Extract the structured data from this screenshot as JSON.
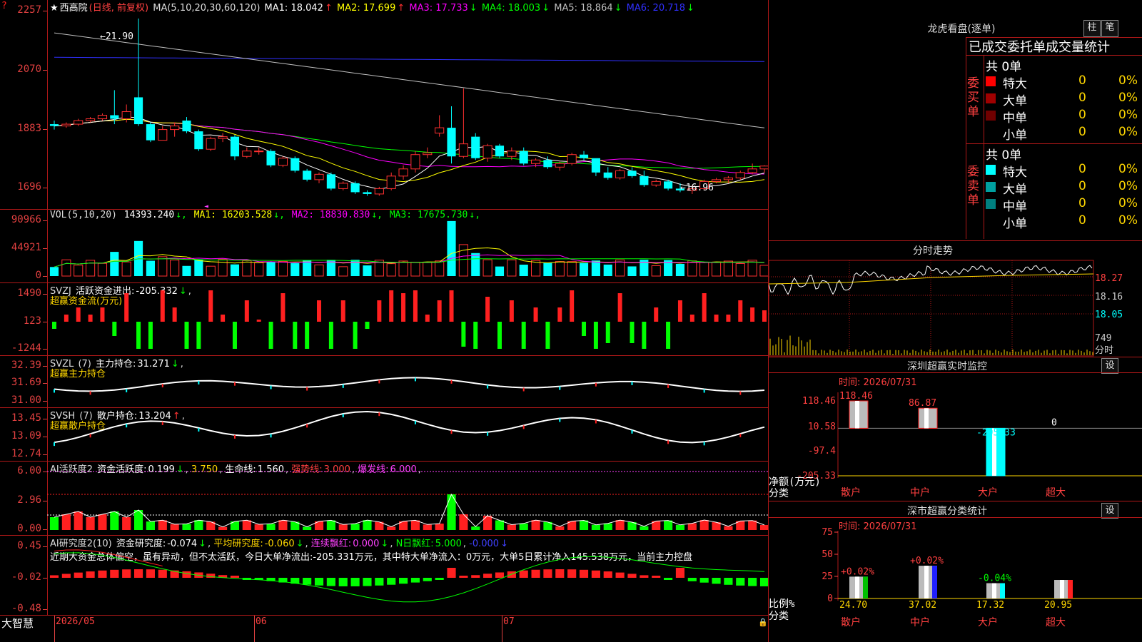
{
  "app": {
    "brand": "大智慧",
    "stock_title": "西高院",
    "period": "(日线, 前复权)",
    "star": "★",
    "marker": "?"
  },
  "main": {
    "ma_params": "MA(5,10,20,30,60,120)",
    "ma": [
      {
        "label": "MA1:",
        "value": "18.042",
        "arrow": "↑",
        "color": "#ffffff"
      },
      {
        "label": "MA2:",
        "value": "17.699",
        "arrow": "↑",
        "color": "#ffff00"
      },
      {
        "label": "MA3:",
        "value": "17.733",
        "arrow": "↓",
        "color": "#ff00ff"
      },
      {
        "label": "MA4:",
        "value": "18.003",
        "arrow": "↓",
        "color": "#00ff00"
      },
      {
        "label": "MA5:",
        "value": "18.864",
        "arrow": "↓",
        "color": "#c0c0c0"
      },
      {
        "label": "MA6:",
        "value": "20.718",
        "arrow": "↓",
        "color": "#3030ff"
      }
    ],
    "y_labels": [
      "2257",
      "2070",
      "1883",
      "1696"
    ],
    "high_label": "21.90",
    "low_label": "16.96"
  },
  "vol": {
    "params": "VOL(5,10,20)",
    "value": "14393.240",
    "items": [
      {
        "label": "MA1:",
        "value": "16203.528",
        "arrow": "↓",
        "color": "#ffff00"
      },
      {
        "label": "MA2:",
        "value": "18830.830",
        "arrow": "↓",
        "color": "#ff00ff"
      },
      {
        "label": "MA3:",
        "value": "17675.730",
        "arrow": "↓",
        "color": "#00ff00"
      }
    ],
    "y_labels": [
      "90966",
      "44921",
      "0"
    ]
  },
  "svzj": {
    "name": "SVZJ",
    "label": "活跃资金进出:",
    "value": "-205.332",
    "arrow": "↓",
    "subtitle": "超赢资金流(万元)",
    "y_labels": [
      "1490",
      "123",
      "-1244"
    ]
  },
  "svzl": {
    "name": "SVZL",
    "params": "(7)",
    "label": "主力持仓:",
    "value": "31.271",
    "arrow": "↓",
    "subtitle": "超赢主力持仓",
    "y_labels": [
      "32.39",
      "31.69",
      "31.00"
    ]
  },
  "svsh": {
    "name": "SVSH",
    "params": "(7)",
    "label": "散户持仓:",
    "value": "13.204",
    "arrow": "↑",
    "subtitle": "超赢散户持仓",
    "y_labels": [
      "13.45",
      "13.09",
      "12.74"
    ]
  },
  "ai_active": {
    "name": "AI活跃度2",
    "label1": "资金活跃度:",
    "v1": "0.199",
    "a1": "↓",
    "v2": "3.750",
    "label3": "生命线:",
    "v3": "1.560",
    "label4": "强势线:",
    "v4": "3.000",
    "label5": "爆发线:",
    "v5": "6.000",
    "y_labels": [
      "6.00",
      "2.96",
      "0.00"
    ]
  },
  "ai_research": {
    "name": "AI研究度2(10)",
    "label1": "资金研究度:",
    "v1": "-0.074",
    "a1": "↓",
    "label2": "平均研究度:",
    "v2": "-0.060",
    "a2": "↓",
    "label3": "连续飘红:",
    "v3": "0.000",
    "a3": "↓",
    "label4": "N日飘红:",
    "v4": "5.000",
    "v5": "-0.000",
    "a5": "↓",
    "comment": "近期大资金总体偏空，虽有异动，但不太活跃，今日大单净流出:-205.331万元，其中特大单净流入：0万元，大单5日累计净入145.538万元，当前主力控盘",
    "y_labels": [
      "0.45",
      "-0.02",
      "-0.48"
    ]
  },
  "x_axis": {
    "labels": [
      "2026/05",
      "06",
      "07"
    ]
  },
  "lhb": {
    "title": "龙虎看盘(逐单)",
    "btn1": "柱",
    "btn2": "笔",
    "tabs": "已成交委托单成交量统计",
    "buy": {
      "side": "委买单",
      "total": "共 0单",
      "rows": [
        {
          "name": "特大",
          "count": "0",
          "pct": "0%",
          "color": "#ff0000"
        },
        {
          "name": "大单",
          "count": "0",
          "pct": "0%",
          "color": "#a00000"
        },
        {
          "name": "中单",
          "count": "0",
          "pct": "0%",
          "color": "#700000"
        },
        {
          "name": "小单",
          "count": "0",
          "pct": "0%",
          "color": "#000000"
        }
      ]
    },
    "sell": {
      "side": "委卖单",
      "total": "共 0单",
      "rows": [
        {
          "name": "特大",
          "count": "0",
          "pct": "0%",
          "color": "#00ffff"
        },
        {
          "name": "大单",
          "count": "0",
          "pct": "0%",
          "color": "#00a0a0"
        },
        {
          "name": "中单",
          "count": "0",
          "pct": "0%",
          "color": "#008080"
        },
        {
          "name": "小单",
          "count": "0",
          "pct": "0%",
          "color": "#000000"
        }
      ]
    }
  },
  "fenshi": {
    "title": "分时走势",
    "y_labels": [
      "18.27",
      "18.16",
      "18.05",
      "749"
    ],
    "unit": "分时"
  },
  "sz_monitor": {
    "title": "深圳超赢实时监控",
    "btn": "设",
    "time_label": "时间:",
    "time": "2026/07/31",
    "y_labels": [
      "118.46",
      "10.58",
      "-97.4",
      "-205.33"
    ],
    "unit": "净额(万元)",
    "cat_label": "分类",
    "categories": [
      "散户",
      "中户",
      "大户",
      "超大"
    ],
    "values": [
      118.46,
      86.87,
      -205.33,
      0
    ],
    "value_labels": [
      "118.46",
      "86.87",
      "-205.33",
      "0"
    ]
  },
  "sz_classify": {
    "title": "深市超赢分类统计",
    "btn": "设",
    "time_label": "时间:",
    "time": "2026/07/31",
    "y_labels": [
      "75",
      "50",
      "25",
      "0"
    ],
    "unit": "比例%",
    "cat_label": "分类",
    "categories": [
      "散户",
      "中户",
      "大户",
      "超大"
    ],
    "values": [
      24.7,
      37.02,
      17.32,
      20.95
    ],
    "changes": [
      "+0.02%",
      "+0.02%",
      "-0.04%",
      ""
    ]
  },
  "chart_data": {
    "type": "candlestick",
    "title": "西高院 (日线, 前复权)",
    "x_axis_labels": [
      "2026/05",
      "06",
      "07"
    ],
    "y_range": [
      16.96,
      21.9
    ],
    "candles": [
      {
        "o": 18.95,
        "h": 19.05,
        "l": 18.8,
        "c": 18.9
      },
      {
        "o": 18.9,
        "h": 19.0,
        "l": 18.85,
        "c": 18.95
      },
      {
        "o": 18.95,
        "h": 19.1,
        "l": 18.9,
        "c": 19.05
      },
      {
        "o": 19.05,
        "h": 19.15,
        "l": 19.0,
        "c": 19.1
      },
      {
        "o": 19.1,
        "h": 19.25,
        "l": 19.05,
        "c": 19.2
      },
      {
        "o": 19.2,
        "h": 19.9,
        "l": 18.95,
        "c": 19.1
      },
      {
        "o": 19.1,
        "h": 19.5,
        "l": 19.0,
        "c": 19.3
      },
      {
        "o": 19.7,
        "h": 21.9,
        "l": 18.9,
        "c": 18.95
      },
      {
        "o": 18.95,
        "h": 19.0,
        "l": 18.45,
        "c": 18.5
      },
      {
        "o": 18.5,
        "h": 18.9,
        "l": 18.5,
        "c": 18.8
      },
      {
        "o": 18.8,
        "h": 19.0,
        "l": 18.6,
        "c": 18.9
      },
      {
        "o": 19.05,
        "h": 19.15,
        "l": 18.7,
        "c": 18.75
      },
      {
        "o": 18.75,
        "h": 18.8,
        "l": 18.2,
        "c": 18.25
      },
      {
        "o": 18.25,
        "h": 18.6,
        "l": 18.2,
        "c": 18.55
      },
      {
        "o": 18.55,
        "h": 18.7,
        "l": 18.45,
        "c": 18.6
      },
      {
        "o": 18.6,
        "h": 18.65,
        "l": 17.95,
        "c": 18.05
      },
      {
        "o": 18.05,
        "h": 18.3,
        "l": 18.0,
        "c": 18.2
      },
      {
        "o": 18.2,
        "h": 18.3,
        "l": 18.1,
        "c": 18.2
      },
      {
        "o": 18.2,
        "h": 18.25,
        "l": 17.75,
        "c": 17.8
      },
      {
        "o": 17.8,
        "h": 18.05,
        "l": 17.75,
        "c": 18.0
      },
      {
        "o": 18.0,
        "h": 18.05,
        "l": 17.6,
        "c": 17.65
      },
      {
        "o": 17.65,
        "h": 17.7,
        "l": 17.35,
        "c": 17.4
      },
      {
        "o": 17.4,
        "h": 17.6,
        "l": 17.3,
        "c": 17.55
      },
      {
        "o": 17.55,
        "h": 17.6,
        "l": 17.1,
        "c": 17.15
      },
      {
        "o": 17.15,
        "h": 17.35,
        "l": 17.1,
        "c": 17.3
      },
      {
        "o": 17.3,
        "h": 17.35,
        "l": 17.0,
        "c": 17.05
      },
      {
        "o": 17.05,
        "h": 17.1,
        "l": 16.95,
        "c": 17.0
      },
      {
        "o": 17.0,
        "h": 17.2,
        "l": 16.95,
        "c": 17.15
      },
      {
        "o": 17.15,
        "h": 17.6,
        "l": 17.1,
        "c": 17.5
      },
      {
        "o": 17.5,
        "h": 17.8,
        "l": 17.4,
        "c": 17.7
      },
      {
        "o": 17.7,
        "h": 18.2,
        "l": 17.6,
        "c": 18.1
      },
      {
        "o": 18.1,
        "h": 18.3,
        "l": 18.0,
        "c": 18.15
      },
      {
        "o": 18.7,
        "h": 19.2,
        "l": 18.6,
        "c": 18.85
      },
      {
        "o": 18.85,
        "h": 19.45,
        "l": 17.85,
        "c": 18.05
      },
      {
        "o": 18.05,
        "h": 19.95,
        "l": 18.0,
        "c": 18.4
      },
      {
        "o": 18.6,
        "h": 18.7,
        "l": 17.95,
        "c": 18.0
      },
      {
        "o": 18.0,
        "h": 18.4,
        "l": 17.9,
        "c": 18.35
      },
      {
        "o": 18.35,
        "h": 18.4,
        "l": 18.0,
        "c": 18.05
      },
      {
        "o": 18.05,
        "h": 18.3,
        "l": 17.95,
        "c": 18.2
      },
      {
        "o": 18.2,
        "h": 18.3,
        "l": 17.8,
        "c": 17.85
      },
      {
        "o": 17.85,
        "h": 18.0,
        "l": 17.75,
        "c": 17.95
      },
      {
        "o": 17.95,
        "h": 18.05,
        "l": 17.7,
        "c": 17.75
      },
      {
        "o": 17.75,
        "h": 17.9,
        "l": 17.65,
        "c": 17.85
      },
      {
        "o": 17.85,
        "h": 18.15,
        "l": 17.8,
        "c": 18.1
      },
      {
        "o": 18.1,
        "h": 18.2,
        "l": 17.95,
        "c": 18.0
      },
      {
        "o": 18.0,
        "h": 17.75,
        "l": 17.5,
        "c": 17.6
      },
      {
        "o": 17.6,
        "h": 17.75,
        "l": 17.4,
        "c": 17.45
      },
      {
        "o": 17.45,
        "h": 17.7,
        "l": 17.4,
        "c": 17.65
      },
      {
        "o": 17.65,
        "h": 17.75,
        "l": 17.45,
        "c": 17.5
      },
      {
        "o": 17.5,
        "h": 17.65,
        "l": 17.2,
        "c": 17.25
      },
      {
        "o": 17.25,
        "h": 17.4,
        "l": 17.2,
        "c": 17.35
      },
      {
        "o": 17.35,
        "h": 17.4,
        "l": 17.1,
        "c": 17.15
      },
      {
        "o": 17.15,
        "h": 17.3,
        "l": 17.05,
        "c": 17.1
      },
      {
        "o": 17.1,
        "h": 17.25,
        "l": 17.0,
        "c": 17.15
      },
      {
        "o": 17.15,
        "h": 17.4,
        "l": 17.1,
        "c": 17.35
      },
      {
        "o": 17.35,
        "h": 17.45,
        "l": 17.3,
        "c": 17.4
      },
      {
        "o": 17.4,
        "h": 17.5,
        "l": 17.3,
        "c": 17.45
      },
      {
        "o": 17.45,
        "h": 17.65,
        "l": 17.4,
        "c": 17.6
      },
      {
        "o": 17.6,
        "h": 17.85,
        "l": 17.55,
        "c": 17.7
      },
      {
        "o": 17.7,
        "h": 17.8,
        "l": 17.6,
        "c": 17.78
      }
    ]
  }
}
